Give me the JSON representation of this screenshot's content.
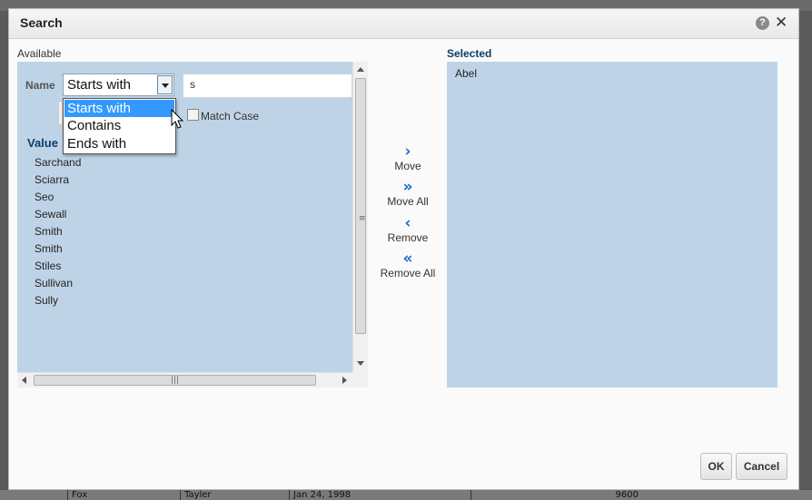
{
  "dialog": {
    "title": "Search"
  },
  "available": {
    "label": "Available",
    "name_label": "Name",
    "operator": {
      "value": "Starts with",
      "options": [
        "Starts with",
        "Contains",
        "Ends with"
      ],
      "highlighted": "Starts with"
    },
    "search_value": "s",
    "match_case_label": "Match Case",
    "match_case_checked": false,
    "value_header": "Value",
    "items": [
      "Sarchand",
      "Sciarra",
      "Seo",
      "Sewall",
      "Smith",
      "Smith",
      "Stiles",
      "Sullivan",
      "Sully"
    ]
  },
  "shuttle": {
    "move": "Move",
    "move_all": "Move All",
    "remove": "Remove",
    "remove_all": "Remove All"
  },
  "selected": {
    "label": "Selected",
    "items": [
      "Abel"
    ]
  },
  "footer": {
    "ok": "OK",
    "cancel": "Cancel"
  },
  "background_row": {
    "c1": "Fox",
    "c2": "Tayler",
    "c3": "Jan 24, 1998",
    "c4": "9600"
  },
  "colors": {
    "panel": "#bed4e6",
    "accent": "#1d6fc1",
    "highlight": "#3399ff",
    "header_text": "#0b3d6b"
  }
}
